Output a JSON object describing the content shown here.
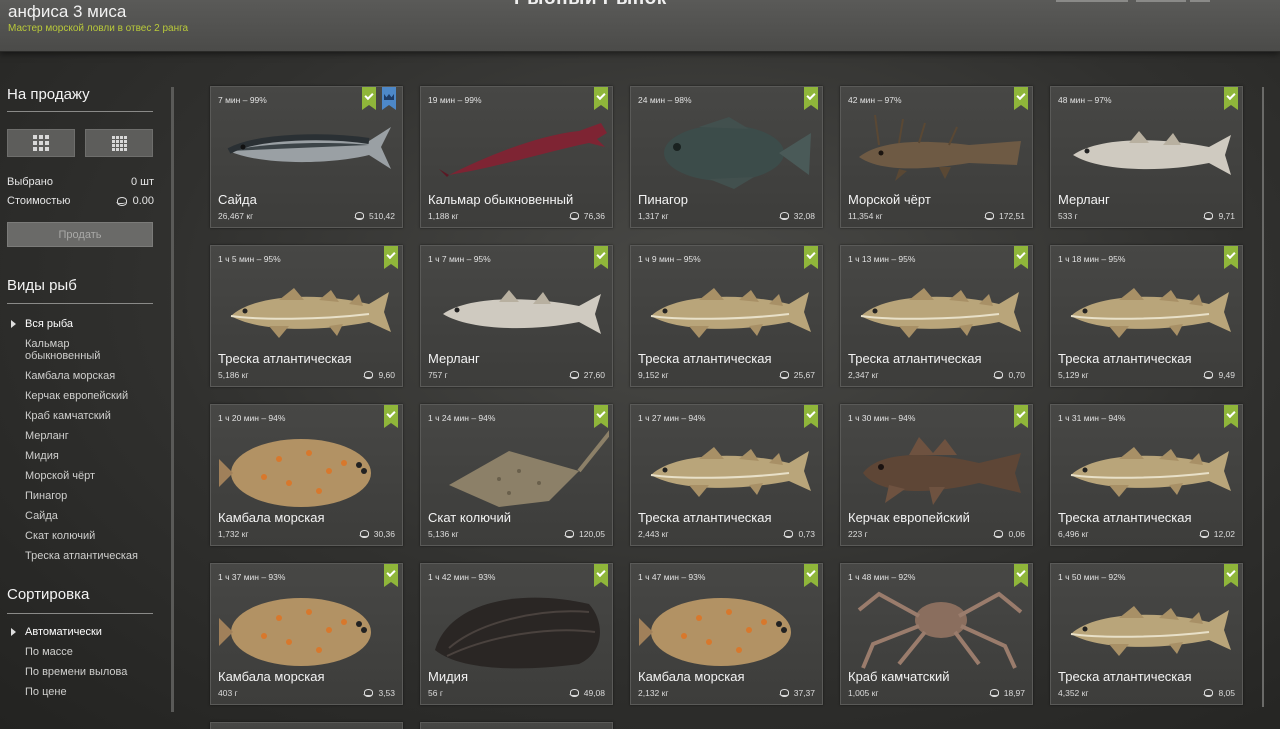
{
  "header": {
    "player_name": "анфиса 3 миса",
    "player_rank": "Мастер морской ловли в отвес 2 ранга",
    "screen_title": "Рыбный Рынок"
  },
  "sidebar": {
    "sale_heading": "На продажу",
    "selected_label": "Выбрано",
    "selected_value": "0 шт",
    "cost_label": "Стоимостью",
    "cost_value": "0.00",
    "sell_button": "Продать",
    "species_heading": "Виды рыб",
    "species": [
      {
        "label": "Вся рыба",
        "active": true
      },
      {
        "label": "Кальмар обыкновенный",
        "active": false
      },
      {
        "label": "Камбала морская",
        "active": false
      },
      {
        "label": "Керчак европейский",
        "active": false
      },
      {
        "label": "Краб камчатский",
        "active": false
      },
      {
        "label": "Мерланг",
        "active": false
      },
      {
        "label": "Мидия",
        "active": false
      },
      {
        "label": "Морской чёрт",
        "active": false
      },
      {
        "label": "Пинагор",
        "active": false
      },
      {
        "label": "Сайда",
        "active": false
      },
      {
        "label": "Скат колючий",
        "active": false
      },
      {
        "label": "Треска атлантическая",
        "active": false
      }
    ],
    "sort_heading": "Сортировка",
    "sort_options": [
      {
        "label": "Автоматически",
        "active": true
      },
      {
        "label": "По массе",
        "active": false
      },
      {
        "label": "По времени вылова",
        "active": false
      },
      {
        "label": "По цене",
        "active": false
      }
    ]
  },
  "catches": [
    {
      "time": "7 мин – 99%",
      "name": "Сайда",
      "weight": "26,467 кг",
      "price": "510,42",
      "icon": "saithe",
      "trophy": true
    },
    {
      "time": "19 мин – 99%",
      "name": "Кальмар обыкновенный",
      "weight": "1,188 кг",
      "price": "76,36",
      "icon": "squid",
      "trophy": false
    },
    {
      "time": "24 мин – 98%",
      "name": "Пинагор",
      "weight": "1,317 кг",
      "price": "32,08",
      "icon": "lumpfish",
      "trophy": false
    },
    {
      "time": "42 мин – 97%",
      "name": "Морской чёрт",
      "weight": "11,354 кг",
      "price": "172,51",
      "icon": "anglerfish",
      "trophy": false
    },
    {
      "time": "48 мин – 97%",
      "name": "Мерланг",
      "weight": "533 г",
      "price": "9,71",
      "icon": "whiting",
      "trophy": false
    },
    {
      "time": "1 ч 5 мин – 95%",
      "name": "Треска атлантическая",
      "weight": "5,186 кг",
      "price": "9,60",
      "icon": "cod",
      "trophy": false
    },
    {
      "time": "1 ч 7 мин – 95%",
      "name": "Мерланг",
      "weight": "757 г",
      "price": "27,60",
      "icon": "whiting",
      "trophy": false
    },
    {
      "time": "1 ч 9 мин – 95%",
      "name": "Треска атлантическая",
      "weight": "9,152 кг",
      "price": "25,67",
      "icon": "cod",
      "trophy": false
    },
    {
      "time": "1 ч 13 мин – 95%",
      "name": "Треска атлантическая",
      "weight": "2,347 кг",
      "price": "0,70",
      "icon": "cod",
      "trophy": false
    },
    {
      "time": "1 ч 18 мин – 95%",
      "name": "Треска атлантическая",
      "weight": "5,129 кг",
      "price": "9,49",
      "icon": "cod",
      "trophy": false
    },
    {
      "time": "1 ч 20 мин – 94%",
      "name": "Камбала морская",
      "weight": "1,732 кг",
      "price": "30,36",
      "icon": "plaice",
      "trophy": false
    },
    {
      "time": "1 ч 24 мин – 94%",
      "name": "Скат колючий",
      "weight": "5,136 кг",
      "price": "120,05",
      "icon": "ray",
      "trophy": false
    },
    {
      "time": "1 ч 27 мин – 94%",
      "name": "Треска атлантическая",
      "weight": "2,443 кг",
      "price": "0,73",
      "icon": "cod",
      "trophy": false
    },
    {
      "time": "1 ч 30 мин – 94%",
      "name": "Керчак европейский",
      "weight": "223 г",
      "price": "0,06",
      "icon": "sculpin",
      "trophy": false
    },
    {
      "time": "1 ч 31 мин – 94%",
      "name": "Треска атлантическая",
      "weight": "6,496 кг",
      "price": "12,02",
      "icon": "cod",
      "trophy": false
    },
    {
      "time": "1 ч 37 мин – 93%",
      "name": "Камбала морская",
      "weight": "403 г",
      "price": "3,53",
      "icon": "plaice",
      "trophy": false
    },
    {
      "time": "1 ч 42 мин – 93%",
      "name": "Мидия",
      "weight": "56 г",
      "price": "49,08",
      "icon": "mussel",
      "trophy": false
    },
    {
      "time": "1 ч 47 мин – 93%",
      "name": "Камбала морская",
      "weight": "2,132 кг",
      "price": "37,37",
      "icon": "plaice",
      "trophy": false
    },
    {
      "time": "1 ч 48 мин – 92%",
      "name": "Краб камчатский",
      "weight": "1,005 кг",
      "price": "18,97",
      "icon": "crab",
      "trophy": false
    },
    {
      "time": "1 ч 50 мин – 92%",
      "name": "Треска атлантическая",
      "weight": "4,352 кг",
      "price": "8,05",
      "icon": "cod",
      "trophy": false
    }
  ],
  "colors": {
    "check_flag": "#8fb63a",
    "trophy_flag": "#4d88c8",
    "rank_text": "#b9c93a"
  }
}
